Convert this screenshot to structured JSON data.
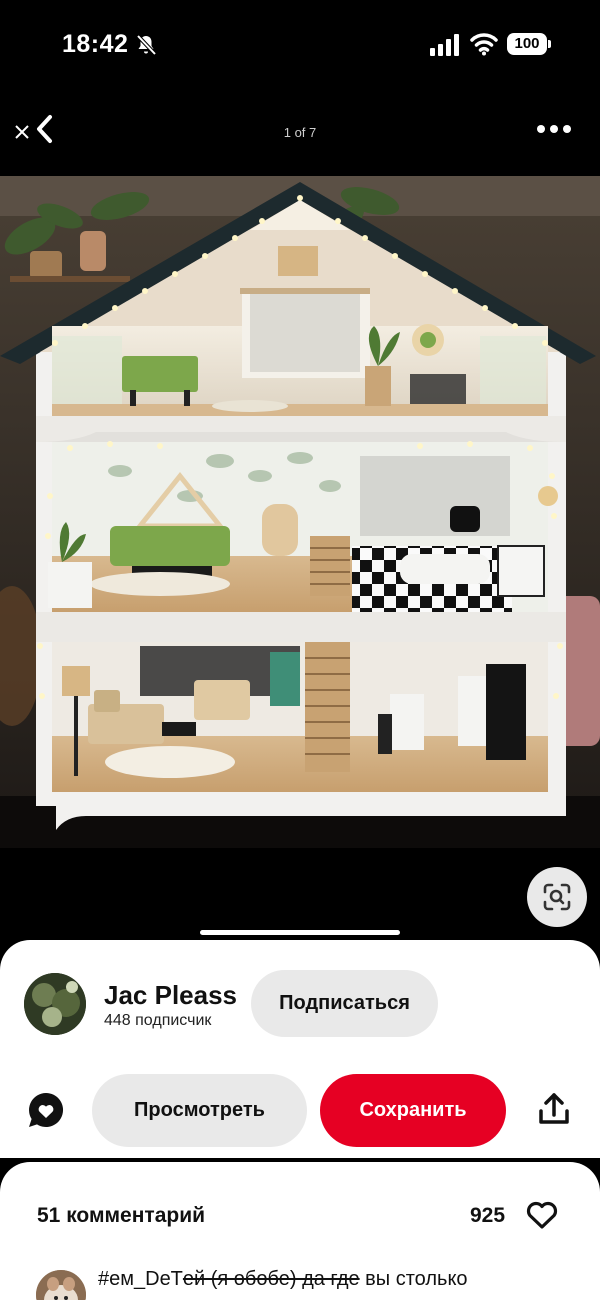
{
  "status_bar": {
    "time": "18:42",
    "battery": "100",
    "icons": [
      "bell-slash-icon",
      "cellular-signal-icon",
      "wifi-icon",
      "battery-icon"
    ]
  },
  "top_nav": {
    "pager": "1 of 7",
    "icons": [
      "close-icon",
      "chevron-left-icon",
      "more-horizontal-icon"
    ]
  },
  "pin": {
    "author": {
      "name": "Jac Pleass",
      "followers": "448 подписчик"
    },
    "subscribe_label": "Подписаться",
    "view_label": "Просмотреть",
    "save_label": "Сохранить",
    "icons": [
      "comment-bubble-icon",
      "share-icon",
      "visual-search-icon"
    ]
  },
  "colors": {
    "save": "#e60023",
    "secondary_button": "#e9e9e9",
    "background": "#000000"
  },
  "comments": {
    "count_label": "51 комментарий",
    "likes": "925",
    "first": {
      "prefix": "#ем_DeT",
      "strike": "ей (я обобе) да где",
      "rest": " вы столько"
    }
  }
}
